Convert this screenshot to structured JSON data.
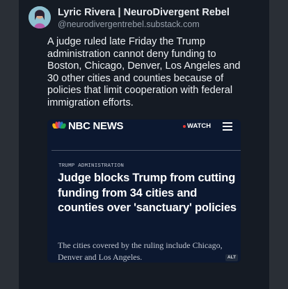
{
  "post": {
    "author_name": "Lyric Rivera | NeuroDivergent Rebel",
    "author_handle": "@neurodivergentrebel.substack.com",
    "text": "A judge ruled late Friday the Trump administration cannot deny funding to Boston, Chicago, Denver, Los Angeles and 30 other cities and counties because of policies that limit cooperation with federal immigration efforts."
  },
  "embed": {
    "brand": "NBC NEWS",
    "watch_label": "WATCH",
    "kicker": "TRUMP ADMINISTRATION",
    "headline": "Judge blocks Trump from cutting funding from 34 cities and counties over 'sanctuary' policies",
    "subhead": "The cities covered by the ruling include Chicago, Denver and Los Angeles.",
    "alt_badge": "ALT"
  },
  "colors": {
    "background": "#151b24",
    "embed_background": "#0c1830",
    "live_dot": "#e53935"
  },
  "icons": [
    "avatar",
    "peacock-logo-icon",
    "live-dot-icon",
    "hamburger-menu-icon"
  ]
}
